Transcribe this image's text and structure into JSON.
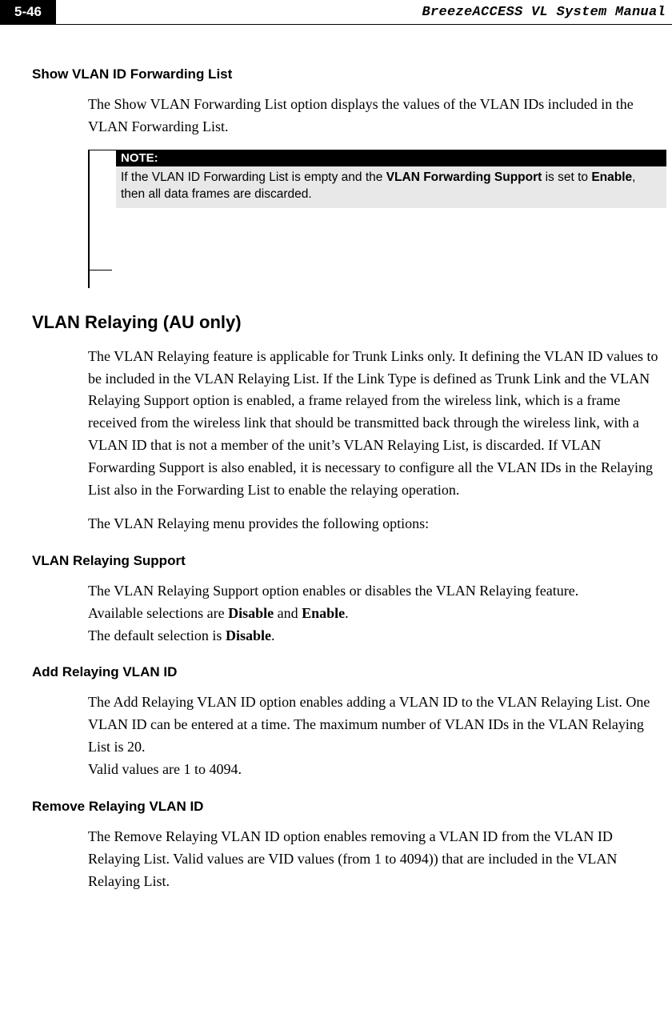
{
  "header": {
    "page_number": "5-46",
    "title": "BreezeACCESS VL System Manual"
  },
  "section1": {
    "heading": "Show VLAN ID Forwarding List",
    "p1": "The Show VLAN Forwarding List option displays the values of the VLAN IDs included in the VLAN Forwarding List."
  },
  "note": {
    "label": "NOTE:",
    "t1": "If the VLAN ID Forwarding List is empty and the ",
    "b1": "VLAN Forwarding Support",
    "t2": " is set to ",
    "b2": "Enable",
    "t3": ", then all data frames are discarded."
  },
  "section2": {
    "heading": "VLAN Relaying (AU only)",
    "p1": "The VLAN Relaying feature is applicable for Trunk Links only. It defining the VLAN ID values to be included in the VLAN Relaying List. If the Link Type is defined as Trunk Link and the VLAN Relaying Support option is enabled, a frame relayed from the wireless link, which is a frame received from the wireless link that should be transmitted back through the wireless link, with a VLAN ID that is not a member of the unit’s VLAN Relaying List, is discarded. If VLAN Forwarding Support is also enabled, it is necessary to configure all the VLAN IDs in the Relaying List also in the Forwarding List to enable the relaying operation.",
    "p2": "The VLAN Relaying menu provides the following options:"
  },
  "section3": {
    "heading": "VLAN Relaying Support",
    "p1a": "The VLAN Relaying Support option enables or disables the VLAN Relaying feature.",
    "p1b_pre": "Available selections are ",
    "p1b_b1": "Disable",
    "p1b_mid": " and ",
    "p1b_b2": "Enable",
    "p1b_post": ".",
    "p1c_pre": "The default selection is ",
    "p1c_b1": "Disable",
    "p1c_post": "."
  },
  "section4": {
    "heading": "Add Relaying VLAN ID",
    "p1": "The Add Relaying VLAN ID option enables adding a VLAN ID to the VLAN Relaying List. One VLAN ID can be entered at a time. The maximum number of VLAN IDs in the VLAN Relaying List is 20.",
    "p2": "Valid values are 1 to 4094."
  },
  "section5": {
    "heading": "Remove Relaying VLAN ID",
    "p1": "The Remove Relaying VLAN ID option enables removing a VLAN ID from the VLAN ID Relaying List. Valid values are VID values (from 1 to 4094)) that are included in the VLAN Relaying List."
  }
}
